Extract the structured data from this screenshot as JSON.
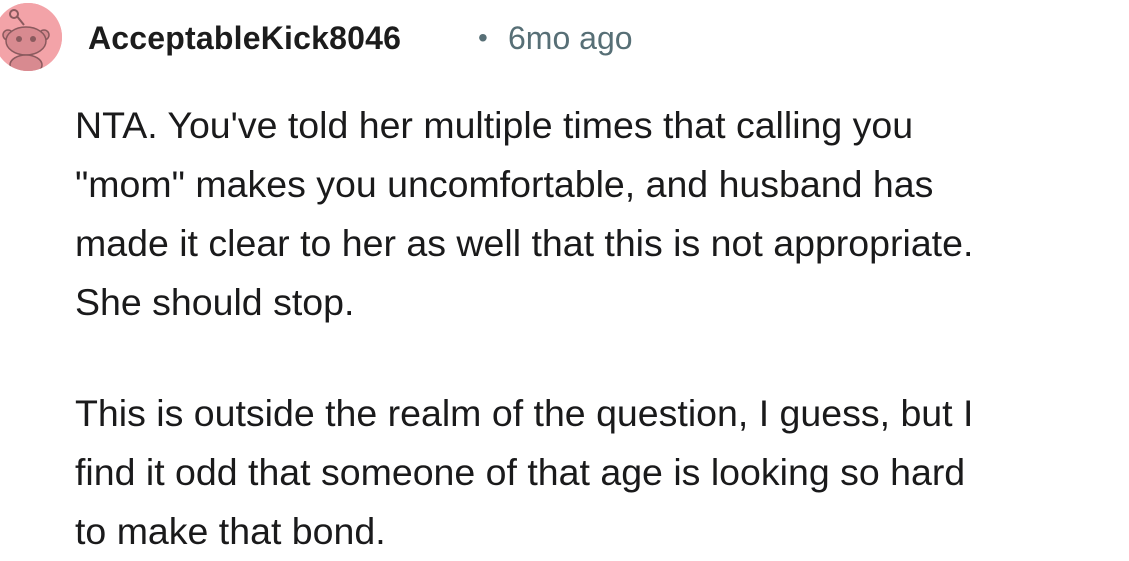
{
  "comment": {
    "author": "AcceptableKick8046",
    "separator": "•",
    "age": "6mo ago",
    "paragraphs": [
      "NTA. You've told her multiple times that calling you\n\"mom\" makes you uncomfortable, and husband has\nmade it clear to her as well that this is not appropriate.\nShe should stop.",
      "This is outside the realm of the question, I guess, but I\nfind it odd that someone of that age is looking so hard\nto make that bond."
    ]
  },
  "avatar": {
    "icon": "reddit-snoo-icon",
    "background_color": "#f3a3a8"
  }
}
